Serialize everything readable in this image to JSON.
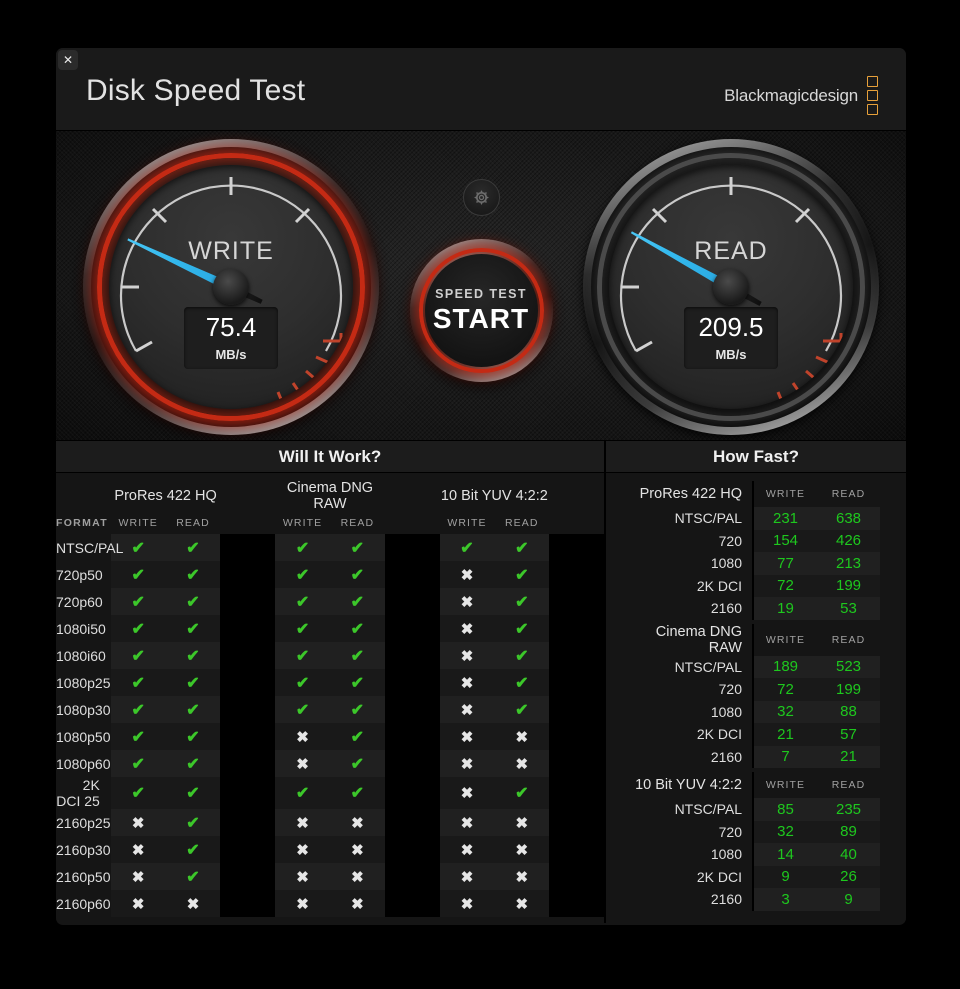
{
  "window": {
    "close_label": "✕",
    "title": "Disk Speed Test",
    "brand": "Blackmagicdesign"
  },
  "colors": {
    "accent_red": "#c42a14",
    "needle_blue": "#34b9ee",
    "ok_green": "#3cc72a",
    "value_green": "#1ec81e",
    "brand_orange": "#e8a13a"
  },
  "gauges": {
    "write": {
      "label": "WRITE",
      "value": "75.4",
      "unit": "MB/s",
      "needle_angle_deg": 205,
      "active": true
    },
    "read": {
      "label": "READ",
      "value": "209.5",
      "unit": "MB/s",
      "needle_angle_deg": 209,
      "active": false
    }
  },
  "start_button": {
    "small_label": "SPEED TEST",
    "big_label": "START",
    "settings_icon": "gear-icon"
  },
  "will_it_work": {
    "title": "Will It Work?",
    "format_header": "FORMAT",
    "groups": [
      "ProRes 422 HQ",
      "Cinema DNG RAW",
      "10 Bit YUV 4:2:2"
    ],
    "sub_headers": [
      "WRITE",
      "READ"
    ],
    "ok_glyph": "✔",
    "no_glyph": "✖",
    "rows": [
      {
        "format": "NTSC/PAL",
        "cells": [
          true,
          true,
          true,
          true,
          true,
          true
        ]
      },
      {
        "format": "720p50",
        "cells": [
          true,
          true,
          true,
          true,
          false,
          true
        ]
      },
      {
        "format": "720p60",
        "cells": [
          true,
          true,
          true,
          true,
          false,
          true
        ]
      },
      {
        "format": "1080i50",
        "cells": [
          true,
          true,
          true,
          true,
          false,
          true
        ]
      },
      {
        "format": "1080i60",
        "cells": [
          true,
          true,
          true,
          true,
          false,
          true
        ]
      },
      {
        "format": "1080p25",
        "cells": [
          true,
          true,
          true,
          true,
          false,
          true
        ]
      },
      {
        "format": "1080p30",
        "cells": [
          true,
          true,
          true,
          true,
          false,
          true
        ]
      },
      {
        "format": "1080p50",
        "cells": [
          true,
          true,
          false,
          true,
          false,
          false
        ]
      },
      {
        "format": "1080p60",
        "cells": [
          true,
          true,
          false,
          true,
          false,
          false
        ]
      },
      {
        "format": "2K DCI 25",
        "cells": [
          true,
          true,
          true,
          true,
          false,
          true
        ]
      },
      {
        "format": "2160p25",
        "cells": [
          false,
          true,
          false,
          false,
          false,
          false
        ]
      },
      {
        "format": "2160p30",
        "cells": [
          false,
          true,
          false,
          false,
          false,
          false
        ]
      },
      {
        "format": "2160p50",
        "cells": [
          false,
          true,
          false,
          false,
          false,
          false
        ]
      },
      {
        "format": "2160p60",
        "cells": [
          false,
          false,
          false,
          false,
          false,
          false
        ]
      }
    ]
  },
  "how_fast": {
    "title": "How Fast?",
    "sub_headers": [
      "WRITE",
      "READ"
    ],
    "groups": [
      {
        "name": "ProRes 422 HQ",
        "rows": [
          {
            "res": "NTSC/PAL",
            "write": "231",
            "read": "638"
          },
          {
            "res": "720",
            "write": "154",
            "read": "426"
          },
          {
            "res": "1080",
            "write": "77",
            "read": "213"
          },
          {
            "res": "2K DCI",
            "write": "72",
            "read": "199"
          },
          {
            "res": "2160",
            "write": "19",
            "read": "53"
          }
        ]
      },
      {
        "name": "Cinema DNG RAW",
        "rows": [
          {
            "res": "NTSC/PAL",
            "write": "189",
            "read": "523"
          },
          {
            "res": "720",
            "write": "72",
            "read": "199"
          },
          {
            "res": "1080",
            "write": "32",
            "read": "88"
          },
          {
            "res": "2K DCI",
            "write": "21",
            "read": "57"
          },
          {
            "res": "2160",
            "write": "7",
            "read": "21"
          }
        ]
      },
      {
        "name": "10 Bit YUV 4:2:2",
        "rows": [
          {
            "res": "NTSC/PAL",
            "write": "85",
            "read": "235"
          },
          {
            "res": "720",
            "write": "32",
            "read": "89"
          },
          {
            "res": "1080",
            "write": "14",
            "read": "40"
          },
          {
            "res": "2K DCI",
            "write": "9",
            "read": "26"
          },
          {
            "res": "2160",
            "write": "3",
            "read": "9"
          }
        ]
      }
    ]
  }
}
